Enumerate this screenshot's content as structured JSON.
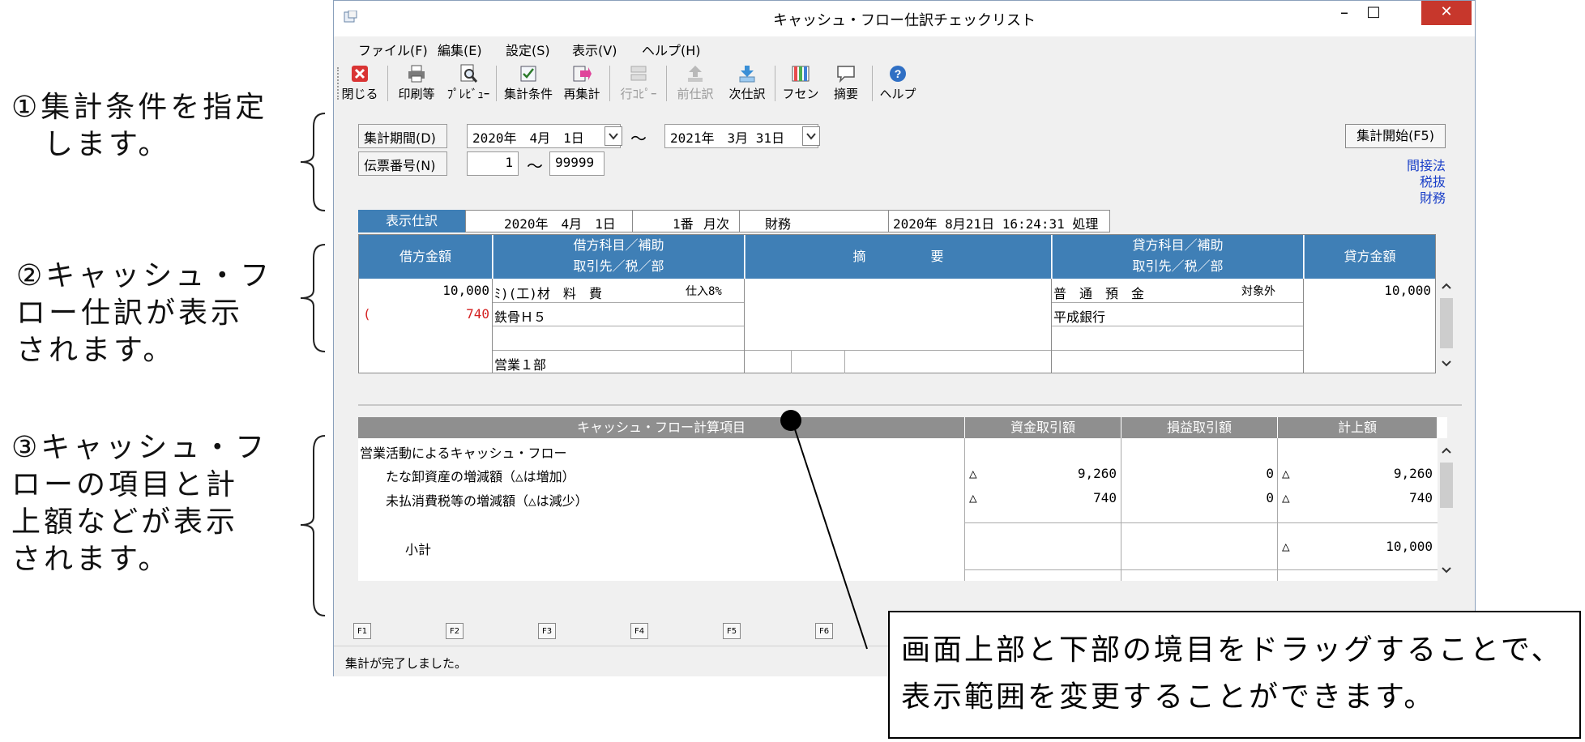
{
  "annotations": {
    "a1": [
      "①集計条件を指定",
      "　します。"
    ],
    "a2": [
      "②キャッシュ・フ",
      "ロー仕訳が表示",
      "されます。"
    ],
    "a3": [
      "③キャッシュ・フ",
      "ローの項目と計",
      "上額などが表示",
      "されます。"
    ],
    "callout": [
      "画面上部と下部の境目をドラッグすることで、",
      "表示範囲を変更することができます。"
    ]
  },
  "window": {
    "title": "キャッシュ・フロー仕訳チェックリスト",
    "minimize": "–",
    "maximize": "□",
    "close": "✕"
  },
  "menu": [
    "ファイル(F)",
    "編集(E)",
    "設定(S)",
    "表示(V)",
    "ヘルプ(H)"
  ],
  "toolbar": [
    {
      "label": "閉じる",
      "icon": "close-icon"
    },
    {
      "label": "印刷等",
      "icon": "printer-icon"
    },
    {
      "label": "ﾌﾟﾚﾋﾞｭｰ",
      "icon": "preview-icon"
    },
    {
      "label": "集計条件",
      "icon": "conditions-icon"
    },
    {
      "label": "再集計",
      "icon": "recalc-icon"
    },
    {
      "label": "行ｺﾋﾟｰ",
      "icon": "row-copy-icon"
    },
    {
      "label": "前仕訳",
      "icon": "prev-entry-icon"
    },
    {
      "label": "次仕訳",
      "icon": "next-entry-icon"
    },
    {
      "label": "フセン",
      "icon": "sticky-note-icon"
    },
    {
      "label": "摘要",
      "icon": "memo-icon"
    },
    {
      "label": "ヘルプ",
      "icon": "help-icon"
    }
  ],
  "conditions": {
    "period_label": "集計期間(D)",
    "period_from": "2020年　4月　1日",
    "tilde": "～",
    "period_to": "2021年　3月 31日",
    "slip_label": "伝票番号(N)",
    "slip_from": "1",
    "slip_to": "99999",
    "start_button": "集計開始(F5)",
    "side_info": [
      "間接法",
      "税抜",
      "財務"
    ]
  },
  "entry": {
    "tab": "表示仕訳",
    "date": "2020年　4月　1日",
    "number": "1番",
    "period": "月次",
    "type": "財務",
    "processed": "2020年 8月21日 16:24:31 処理",
    "headers": {
      "debit_amount": "借方金額",
      "debit_account": [
        "借方科目／補助",
        "取引先／税／部"
      ],
      "summary": "摘　　　　　要",
      "credit_account": [
        "貸方科目／補助",
        "取引先／税／部"
      ],
      "credit_amount": "貸方金額"
    },
    "debit_amount": "10,000",
    "debit_tax_prefix": "(",
    "debit_tax": "740",
    "debit_account": "ﾐ)(工)材　料　費",
    "debit_tax_class": "仕入8%",
    "debit_sub": "鉄骨Ｈ５",
    "debit_dept": "営業１部",
    "credit_account": "普　通　預　金",
    "credit_tax_class": "対象外",
    "credit_sub": "平成銀行",
    "credit_amount": "10,000"
  },
  "cashflow": {
    "headers": {
      "item": "キャッシュ・フロー計算項目",
      "fund": "資金取引額",
      "pl": "損益取引額",
      "posted": "計上額"
    },
    "rows": [
      {
        "item": "営業活動によるキャッシュ・フロー",
        "fund_mark": "",
        "fund": "",
        "pl": "",
        "posted_mark": "",
        "posted": ""
      },
      {
        "item": "　たな卸資産の増減額（△は増加）",
        "fund_mark": "△",
        "fund": "9,260",
        "pl": "0",
        "posted_mark": "△",
        "posted": "9,260"
      },
      {
        "item": "　未払消費税等の増減額（△は減少）",
        "fund_mark": "△",
        "fund": "740",
        "pl": "0",
        "posted_mark": "△",
        "posted": "740"
      }
    ],
    "subtotal_label": "小計",
    "subtotal_mark": "△",
    "subtotal": "10,000"
  },
  "fkeys": [
    "F1",
    "F2",
    "F3",
    "F4",
    "F5",
    "F6"
  ],
  "status": "集計が完了しました。"
}
